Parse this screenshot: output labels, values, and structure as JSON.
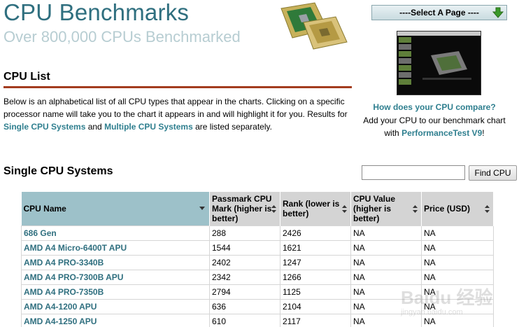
{
  "header": {
    "title": "CPU Benchmarks",
    "subtitle": "Over 800,000 CPUs Benchmarked"
  },
  "page_select": {
    "label": "----Select A Page ----"
  },
  "promo": {
    "link_text": "How does your CPU compare?",
    "line_prefix": "Add your CPU to our benchmark chart",
    "line_with": "with ",
    "product_link": "PerformanceTest V9",
    "line_suffix": "!"
  },
  "cpu_list": {
    "heading": "CPU List",
    "intro_part1": "Below is an alphabetical list of all CPU types that appear in the charts. Clicking on a specific processor name will take you to the chart it appears in and will highlight it for you. Results for ",
    "single_link": "Single CPU Systems",
    "intro_part2": " and ",
    "multiple_link": "Multiple CPU Systems",
    "intro_part3": " are listed separately."
  },
  "single": {
    "heading": "Single CPU Systems",
    "search_value": "",
    "find_button": "Find CPU"
  },
  "table": {
    "columns": [
      "CPU Name",
      "Passmark CPU Mark (higher is better)",
      "Rank (lower is better)",
      "CPU Value (higher is better)",
      "Price (USD)"
    ],
    "rows": [
      [
        "686 Gen",
        "288",
        "2426",
        "NA",
        "NA"
      ],
      [
        "AMD A4 Micro-6400T APU",
        "1544",
        "1621",
        "NA",
        "NA"
      ],
      [
        "AMD A4 PRO-3340B",
        "2402",
        "1247",
        "NA",
        "NA"
      ],
      [
        "AMD A4 PRO-7300B APU",
        "2342",
        "1266",
        "NA",
        "NA"
      ],
      [
        "AMD A4 PRO-7350B",
        "2794",
        "1125",
        "NA",
        "NA"
      ],
      [
        "AMD A4-1200 APU",
        "636",
        "2104",
        "NA",
        "NA"
      ],
      [
        "AMD A4-1250 APU",
        "610",
        "2117",
        "NA",
        "NA"
      ]
    ]
  },
  "watermark": {
    "main": "Baidu 经验",
    "sub": "jingyan.baidu.com"
  },
  "colors": {
    "title": "#2f6f7f",
    "accent_rule": "#a33c1f",
    "link": "#2f7f8f",
    "sorted_header": "#9dc1c9"
  }
}
